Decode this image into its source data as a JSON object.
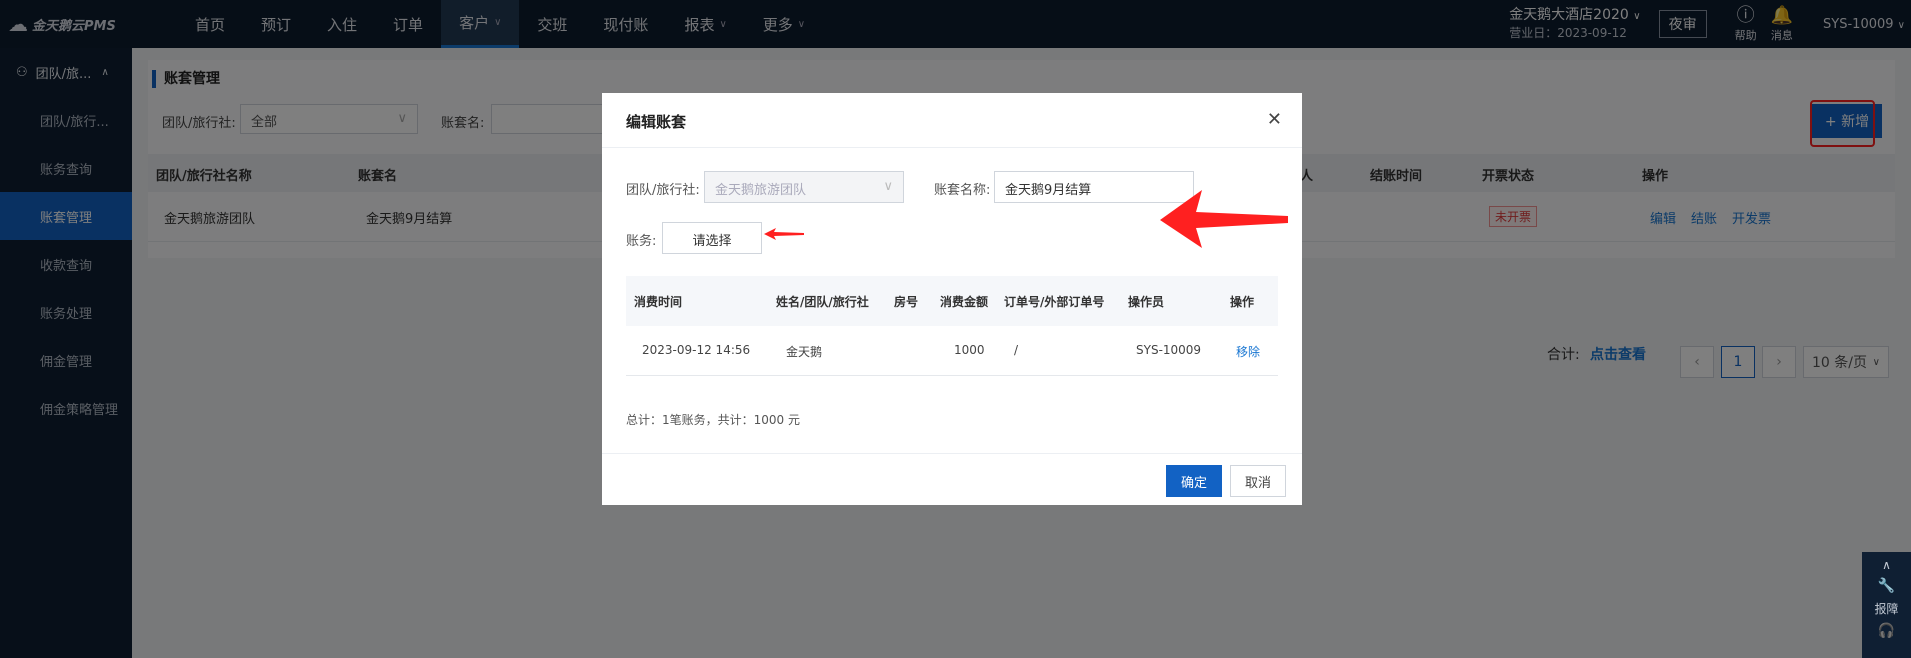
{
  "app": {
    "logo_text": "金天鹅云PMS"
  },
  "nav": {
    "items": [
      {
        "label": "首页"
      },
      {
        "label": "预订"
      },
      {
        "label": "入住"
      },
      {
        "label": "订单"
      },
      {
        "label": "客户"
      },
      {
        "label": "交班"
      },
      {
        "label": "现付账"
      },
      {
        "label": "报表"
      },
      {
        "label": "更多"
      }
    ]
  },
  "header": {
    "hotel_name": "金天鹅大酒店2020",
    "business_date": "营业日：2023-09-12",
    "night_audit": "夜审",
    "help": "帮助",
    "messages": "消息",
    "user": "SYS-10009"
  },
  "sidebar": {
    "group": "团队/旅...",
    "items": [
      {
        "label": "团队/旅行..."
      },
      {
        "label": "账务查询"
      },
      {
        "label": "账套管理"
      },
      {
        "label": "收款查询"
      },
      {
        "label": "账务处理"
      },
      {
        "label": "佣金管理"
      },
      {
        "label": "佣金策略管理"
      }
    ]
  },
  "page": {
    "title": "账套管理",
    "filter_agency_label": "团队/旅行社:",
    "filter_agency_value": "全部",
    "filter_name_label": "账套名:",
    "add_button": "+ 新增",
    "columns": [
      "团队/旅行社名称",
      "账套名",
      "人",
      "结账时间",
      "开票状态",
      "操作"
    ],
    "row": {
      "agency": "金天鹅旅游团队",
      "name": "金天鹅9月结算",
      "invoice_status": "未开票",
      "actions": [
        "编辑",
        "结账",
        "开发票"
      ]
    },
    "total_label": "合计:",
    "total_link": "点击查看",
    "current_page": "1",
    "page_size": "10 条/页"
  },
  "modal": {
    "title": "编辑账套",
    "agency_label": "团队/旅行社:",
    "agency_value": "金天鹅旅游团队",
    "name_label": "账套名称:",
    "name_value": "金天鹅9月结算",
    "account_label": "账务:",
    "account_placeholder": "请选择",
    "columns": [
      "消费时间",
      "姓名/团队/旅行社",
      "房号",
      "消费金额",
      "订单号/外部订单号",
      "操作员",
      "操作"
    ],
    "row": {
      "time": "2023-09-12 14:56",
      "name": "金天鹅",
      "room": "",
      "amount": "1000",
      "order": "/",
      "operator": "SYS-10009",
      "action": "移除"
    },
    "summary": "总计：1笔账务，共计：1000 元",
    "ok": "确定",
    "cancel": "取消"
  },
  "floatbar": {
    "report": "报障"
  },
  "colors": {
    "primary": "#1262c4",
    "topbar": "#0d1c2f",
    "highlight": "#ff2020"
  }
}
